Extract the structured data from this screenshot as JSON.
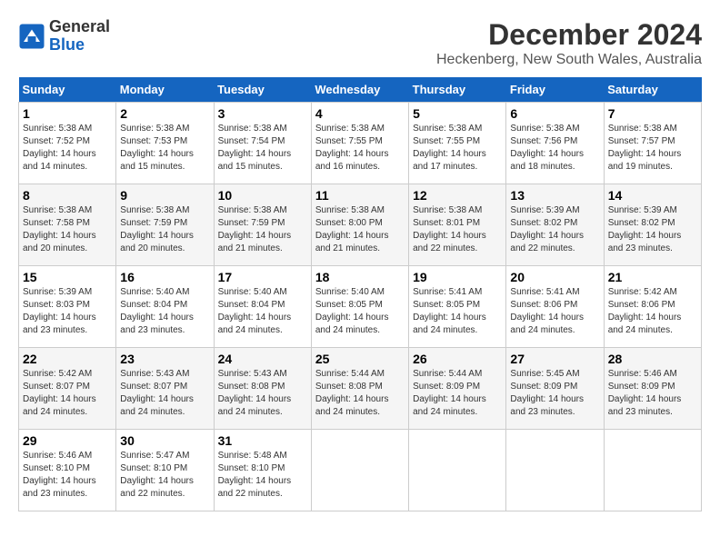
{
  "header": {
    "logo_line1": "General",
    "logo_line2": "Blue",
    "month": "December 2024",
    "location": "Heckenberg, New South Wales, Australia"
  },
  "days_of_week": [
    "Sunday",
    "Monday",
    "Tuesday",
    "Wednesday",
    "Thursday",
    "Friday",
    "Saturday"
  ],
  "weeks": [
    [
      {
        "day": "1",
        "info": "Sunrise: 5:38 AM\nSunset: 7:52 PM\nDaylight: 14 hours\nand 14 minutes."
      },
      {
        "day": "2",
        "info": "Sunrise: 5:38 AM\nSunset: 7:53 PM\nDaylight: 14 hours\nand 15 minutes."
      },
      {
        "day": "3",
        "info": "Sunrise: 5:38 AM\nSunset: 7:54 PM\nDaylight: 14 hours\nand 15 minutes."
      },
      {
        "day": "4",
        "info": "Sunrise: 5:38 AM\nSunset: 7:55 PM\nDaylight: 14 hours\nand 16 minutes."
      },
      {
        "day": "5",
        "info": "Sunrise: 5:38 AM\nSunset: 7:55 PM\nDaylight: 14 hours\nand 17 minutes."
      },
      {
        "day": "6",
        "info": "Sunrise: 5:38 AM\nSunset: 7:56 PM\nDaylight: 14 hours\nand 18 minutes."
      },
      {
        "day": "7",
        "info": "Sunrise: 5:38 AM\nSunset: 7:57 PM\nDaylight: 14 hours\nand 19 minutes."
      }
    ],
    [
      {
        "day": "8",
        "info": "Sunrise: 5:38 AM\nSunset: 7:58 PM\nDaylight: 14 hours\nand 20 minutes."
      },
      {
        "day": "9",
        "info": "Sunrise: 5:38 AM\nSunset: 7:59 PM\nDaylight: 14 hours\nand 20 minutes."
      },
      {
        "day": "10",
        "info": "Sunrise: 5:38 AM\nSunset: 7:59 PM\nDaylight: 14 hours\nand 21 minutes."
      },
      {
        "day": "11",
        "info": "Sunrise: 5:38 AM\nSunset: 8:00 PM\nDaylight: 14 hours\nand 21 minutes."
      },
      {
        "day": "12",
        "info": "Sunrise: 5:38 AM\nSunset: 8:01 PM\nDaylight: 14 hours\nand 22 minutes."
      },
      {
        "day": "13",
        "info": "Sunrise: 5:39 AM\nSunset: 8:02 PM\nDaylight: 14 hours\nand 22 minutes."
      },
      {
        "day": "14",
        "info": "Sunrise: 5:39 AM\nSunset: 8:02 PM\nDaylight: 14 hours\nand 23 minutes."
      }
    ],
    [
      {
        "day": "15",
        "info": "Sunrise: 5:39 AM\nSunset: 8:03 PM\nDaylight: 14 hours\nand 23 minutes."
      },
      {
        "day": "16",
        "info": "Sunrise: 5:40 AM\nSunset: 8:04 PM\nDaylight: 14 hours\nand 23 minutes."
      },
      {
        "day": "17",
        "info": "Sunrise: 5:40 AM\nSunset: 8:04 PM\nDaylight: 14 hours\nand 24 minutes."
      },
      {
        "day": "18",
        "info": "Sunrise: 5:40 AM\nSunset: 8:05 PM\nDaylight: 14 hours\nand 24 minutes."
      },
      {
        "day": "19",
        "info": "Sunrise: 5:41 AM\nSunset: 8:05 PM\nDaylight: 14 hours\nand 24 minutes."
      },
      {
        "day": "20",
        "info": "Sunrise: 5:41 AM\nSunset: 8:06 PM\nDaylight: 14 hours\nand 24 minutes."
      },
      {
        "day": "21",
        "info": "Sunrise: 5:42 AM\nSunset: 8:06 PM\nDaylight: 14 hours\nand 24 minutes."
      }
    ],
    [
      {
        "day": "22",
        "info": "Sunrise: 5:42 AM\nSunset: 8:07 PM\nDaylight: 14 hours\nand 24 minutes."
      },
      {
        "day": "23",
        "info": "Sunrise: 5:43 AM\nSunset: 8:07 PM\nDaylight: 14 hours\nand 24 minutes."
      },
      {
        "day": "24",
        "info": "Sunrise: 5:43 AM\nSunset: 8:08 PM\nDaylight: 14 hours\nand 24 minutes."
      },
      {
        "day": "25",
        "info": "Sunrise: 5:44 AM\nSunset: 8:08 PM\nDaylight: 14 hours\nand 24 minutes."
      },
      {
        "day": "26",
        "info": "Sunrise: 5:44 AM\nSunset: 8:09 PM\nDaylight: 14 hours\nand 24 minutes."
      },
      {
        "day": "27",
        "info": "Sunrise: 5:45 AM\nSunset: 8:09 PM\nDaylight: 14 hours\nand 23 minutes."
      },
      {
        "day": "28",
        "info": "Sunrise: 5:46 AM\nSunset: 8:09 PM\nDaylight: 14 hours\nand 23 minutes."
      }
    ],
    [
      {
        "day": "29",
        "info": "Sunrise: 5:46 AM\nSunset: 8:10 PM\nDaylight: 14 hours\nand 23 minutes."
      },
      {
        "day": "30",
        "info": "Sunrise: 5:47 AM\nSunset: 8:10 PM\nDaylight: 14 hours\nand 22 minutes."
      },
      {
        "day": "31",
        "info": "Sunrise: 5:48 AM\nSunset: 8:10 PM\nDaylight: 14 hours\nand 22 minutes."
      },
      {
        "day": "",
        "info": ""
      },
      {
        "day": "",
        "info": ""
      },
      {
        "day": "",
        "info": ""
      },
      {
        "day": "",
        "info": ""
      }
    ]
  ]
}
